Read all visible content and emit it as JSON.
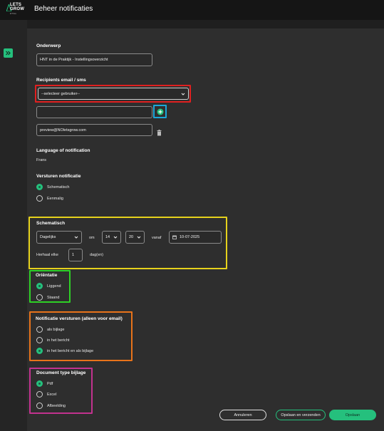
{
  "app": {
    "logo_line1": "LETS",
    "logo_line2": "GROW",
    "logo_line3": "RTSG",
    "title": "Beheer notificaties"
  },
  "colors": {
    "accent": "#25c07d",
    "highlight_red": "#e02020",
    "highlight_blue": "#1aa7d9",
    "highlight_yellow": "#e6d21c",
    "highlight_green": "#2ed126",
    "highlight_orange": "#e8731a",
    "highlight_magenta": "#c2328f"
  },
  "subject": {
    "label": "Onderwerp",
    "value": "HNT in de Praktijk - Instellingsoverzicht"
  },
  "recipients": {
    "label": "Recipients email / sms",
    "select_value": "--selecteer gebruiker--",
    "input_value": "",
    "add_icon": "plus-circle-icon",
    "preview_email": "preview@NOletsgrow.com",
    "delete_icon": "trash-icon"
  },
  "language": {
    "label": "Language of notification",
    "value": "Frans"
  },
  "sending": {
    "label": "Versturen notificatie",
    "options": [
      "Schematisch",
      "Eenmalig"
    ],
    "selected": 0
  },
  "schedule": {
    "label": "Schematisch",
    "frequency": "Dagelijks",
    "at_label": "om",
    "hour": "14",
    "minute": "20",
    "from_label": "vanaf",
    "date": "10-07-2025",
    "calendar_icon": "calendar-icon",
    "repeat_label": "Herhaal elke",
    "repeat_value": "1",
    "repeat_unit": "dag(en)"
  },
  "orientation": {
    "label": "Oriëntatie",
    "options": [
      "Liggend",
      "Staand"
    ],
    "selected": 0
  },
  "send_notification": {
    "label": "Notificatie versturen (alleen voor email)",
    "options": [
      "als bijlage",
      "in het bericht",
      "in het bericht en als bijlage"
    ],
    "selected": 2
  },
  "doc_type": {
    "label": "Document type bijlage",
    "options": [
      "Pdf",
      "Excel",
      "Afbeelding"
    ],
    "selected": 0
  },
  "actions": {
    "cancel": "Annuleren",
    "save_send": "Opslaan en verzenden",
    "save": "Opslaan"
  }
}
